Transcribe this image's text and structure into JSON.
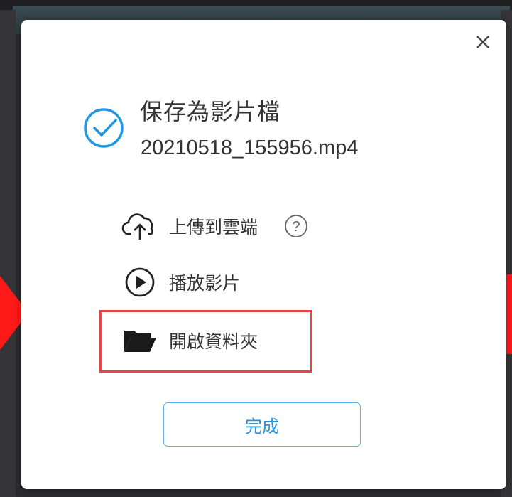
{
  "dialog": {
    "title": "保存為影片檔",
    "filename": "20210518_155956.mp4",
    "close_icon": "close-icon",
    "status_icon": "check-circle-icon",
    "accent_color": "#2196e3",
    "actions": [
      {
        "label": "上傳到雲端",
        "icon": "cloud-upload-icon",
        "has_help": true
      },
      {
        "label": "播放影片",
        "icon": "play-circle-icon"
      },
      {
        "label": "開啟資料夾",
        "icon": "folder-open-icon",
        "highlighted": true
      }
    ],
    "done_label": "完成",
    "highlight_color": "#e8464a"
  },
  "annotations": {
    "arrow_color": "#ff1a1a"
  }
}
